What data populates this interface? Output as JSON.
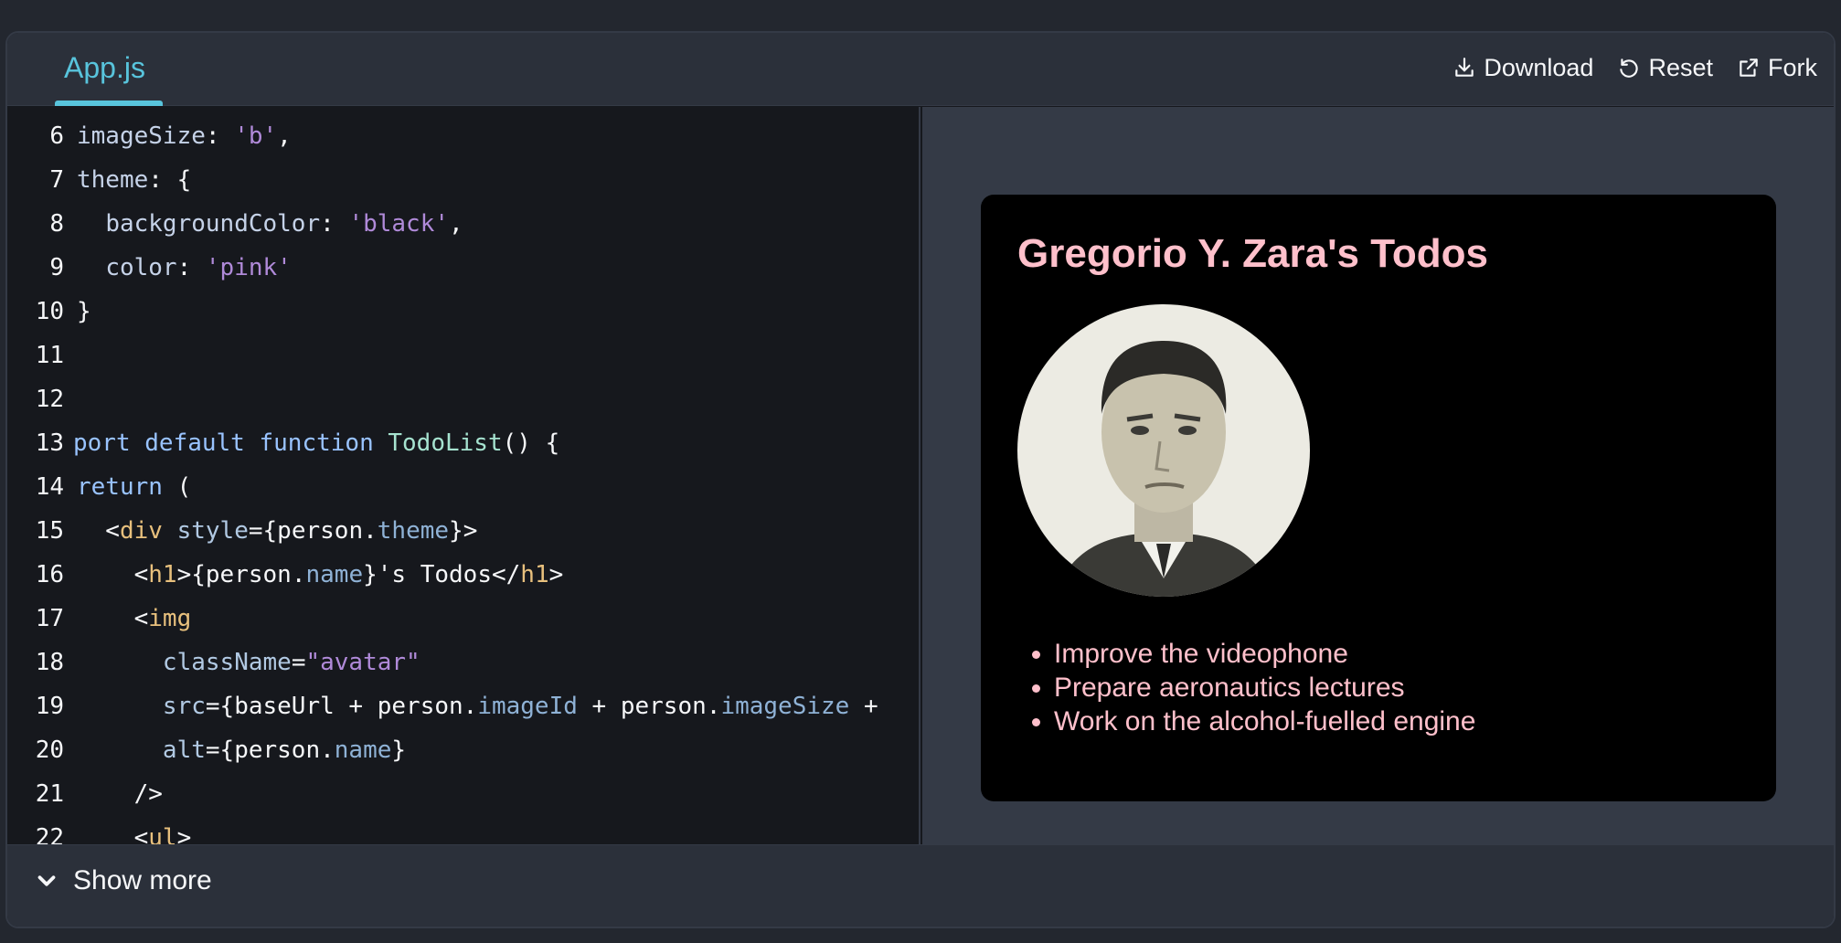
{
  "header": {
    "tab_label": "App.js",
    "actions": {
      "download": "Download",
      "reset": "Reset",
      "fork": "Fork"
    }
  },
  "editor": {
    "lines": [
      {
        "n": "6"
      },
      {
        "n": "7"
      },
      {
        "n": "8"
      },
      {
        "n": "9"
      },
      {
        "n": "10"
      },
      {
        "n": "11"
      },
      {
        "n": "12"
      },
      {
        "n": "13"
      },
      {
        "n": "14"
      },
      {
        "n": "15"
      },
      {
        "n": "16"
      },
      {
        "n": "17"
      },
      {
        "n": "18"
      },
      {
        "n": "19"
      },
      {
        "n": "20"
      },
      {
        "n": "21"
      },
      {
        "n": "22"
      }
    ]
  },
  "preview": {
    "heading": "Gregorio Y. Zara's Todos",
    "todos": [
      "Improve the videophone",
      "Prepare aeronautics lectures",
      "Work on the alcohol-fuelled engine"
    ],
    "theme": {
      "background": "#000000",
      "color": "pink"
    }
  },
  "footer": {
    "show_more": "Show more"
  },
  "colors": {
    "accent": "#58c4dc",
    "panel": "#2b303a",
    "editor_bg": "#16181d"
  }
}
